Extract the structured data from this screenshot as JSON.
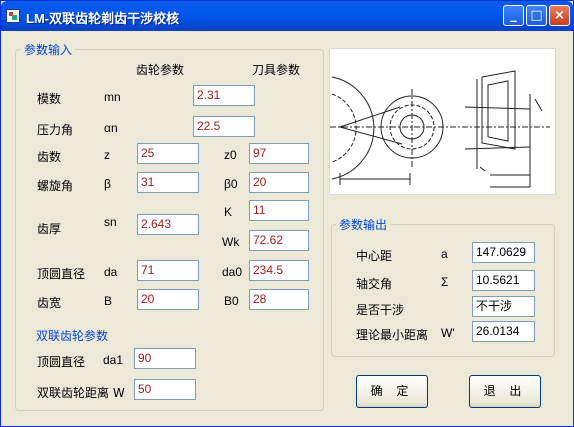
{
  "window": {
    "title": "LM-双联齿轮剃齿干涉校核",
    "buttons": {
      "minimize": "_",
      "maximize": "□",
      "close": "×"
    }
  },
  "input_group": {
    "title": "参数输入",
    "col_gear": "齿轮参数",
    "col_tool": "刀具参数",
    "rows": {
      "module": {
        "label": "模数",
        "symbol": "mn",
        "value": "2.31"
      },
      "pressure": {
        "label": "压力角",
        "symbol": "αn",
        "value": "22.5"
      },
      "teeth": {
        "label": "齿数",
        "symbol": "z",
        "value": "25",
        "tool_symbol": "z0",
        "tool_value": "97"
      },
      "helix": {
        "label": "螺旋角",
        "symbol": "β",
        "value": "31",
        "tool_symbol": "β0",
        "tool_value": "20"
      },
      "thickness": {
        "label": "齿厚",
        "symbol": "sn",
        "value": "2.643",
        "k_symbol": "K",
        "k_value": "11",
        "wk_symbol": "Wk",
        "wk_value": "72.62"
      },
      "tip_diameter": {
        "label": "顶圆直径",
        "symbol": "da",
        "value": "71",
        "tool_symbol": "da0",
        "tool_value": "234.5"
      },
      "width": {
        "label": "齿宽",
        "symbol": "B",
        "value": "20",
        "tool_symbol": "B0",
        "tool_value": "28"
      }
    },
    "dual": {
      "title": "双联齿轮参数",
      "tip_label": "顶圆直径",
      "tip_symbol": "da1",
      "tip_value": "90",
      "dist_label": "双联齿轮距离 W",
      "dist_value": "50"
    }
  },
  "output_group": {
    "title": "参数输出",
    "rows": {
      "center": {
        "label": "中心距",
        "symbol": "a",
        "value": "147.0629"
      },
      "axis": {
        "label": "轴交角",
        "symbol": "Σ",
        "value": "10.5621"
      },
      "interfere": {
        "label": "是否干涉",
        "value": "不干涉"
      },
      "min_dist": {
        "label": "理论最小距离",
        "symbol": "W'",
        "value": "26.0134"
      }
    }
  },
  "actions": {
    "ok": "确 定",
    "exit": "退 出"
  }
}
